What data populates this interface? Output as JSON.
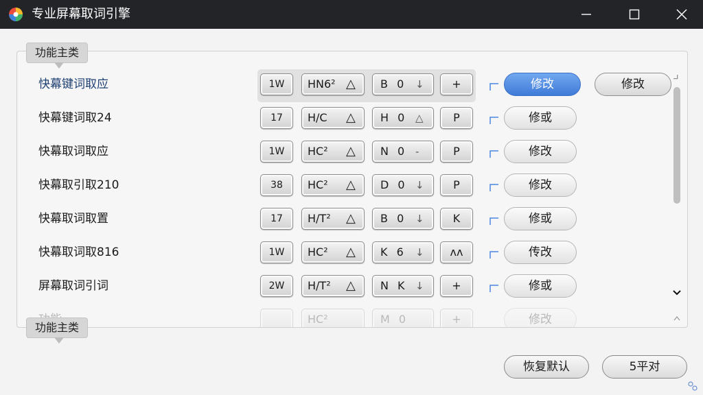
{
  "window": {
    "title": "专业屏幕取词引擎",
    "icon": "app-logo-icon"
  },
  "group_label_top": "功能主类",
  "group_label_bottom": "功能主类",
  "rows": [
    {
      "label": "快幕键词取应",
      "k1": "1W",
      "k2": "HN6²",
      "k2sym": "△",
      "k3": "B 0",
      "k3sym": "↓",
      "k4": "+",
      "action": "修改",
      "extra": "修改"
    },
    {
      "label": "快幕键词取24",
      "k1": "17",
      "k2": "H/C",
      "k2sym": "△",
      "k3": "H 0",
      "k3sym": "△",
      "k4": "P",
      "action": "修或"
    },
    {
      "label": "快幕取词取应",
      "k1": "1W",
      "k2": "HC²",
      "k2sym": "△",
      "k3": "N 0",
      "k3sym": "-",
      "k4": "P",
      "action": "修改"
    },
    {
      "label": "快幕取引取210",
      "k1": "38",
      "k2": "HC²",
      "k2sym": "△",
      "k3": "D 0",
      "k3sym": "↓",
      "k4": "P",
      "action": "修改"
    },
    {
      "label": "快幕取词取置",
      "k1": "17",
      "k2": "H/T²",
      "k2sym": "△",
      "k3": "B 0",
      "k3sym": "↓",
      "k4": "K",
      "action": "修或"
    },
    {
      "label": "快幕取词取816",
      "k1": "1W",
      "k2": "HC²",
      "k2sym": "△",
      "k3": "K 6",
      "k3sym": "↓",
      "k4": "ʌʌ",
      "action": "传改"
    },
    {
      "label": "屏幕取词引词",
      "k1": "2W",
      "k2": "H/T²",
      "k2sym": "△",
      "k3": "N K",
      "k3sym": "↓",
      "k4": "+",
      "action": "修或"
    }
  ],
  "ghost_row": {
    "label": "功能",
    "k1": "",
    "k2": "HC²",
    "k2sym": "",
    "k3": "M 0",
    "k3sym": "",
    "k4": "+",
    "action": "修改"
  },
  "footer": {
    "restore": "恢复默认",
    "apply": "5平对"
  },
  "colors": {
    "titlebar": "#222428",
    "accent": "#4a86e0"
  }
}
